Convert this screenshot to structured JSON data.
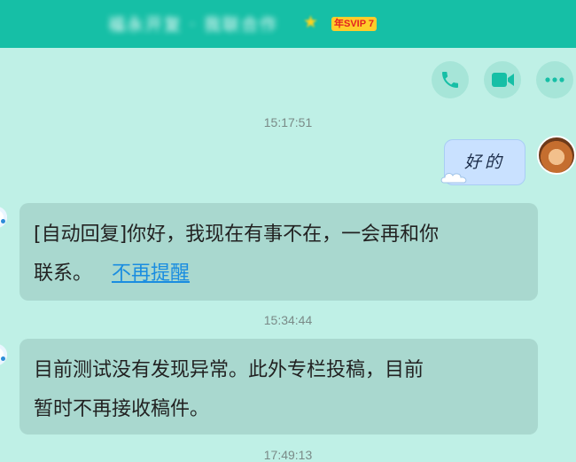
{
  "header": {
    "contact_name": "福永开复 · 我联合作",
    "vip_badge": "年SVIP 7",
    "star_icon": "star-icon"
  },
  "actions": {
    "call": "phone-icon",
    "video": "video-camera-icon",
    "more": "more-dots-icon"
  },
  "messages": [
    {
      "timestamp": "15:17:51",
      "side": "right",
      "text": "好的"
    },
    {
      "side": "left",
      "prefix": "[自动回复]",
      "text_line1": "你好，我现在有事不在，一会再和你",
      "text_line2": "联系。",
      "link": "不再提醒"
    },
    {
      "timestamp": "15:34:44",
      "side": "left",
      "text_line1": "目前测试没有发现异常。此外专栏投稿，目前",
      "text_line2": "暂时不再接收稿件。"
    },
    {
      "timestamp": "17:49:13"
    }
  ],
  "colors": {
    "header": "#16bfa6",
    "background": "#bff0e6",
    "bubble_left": "#a9d8cf",
    "bubble_right": "#c9e1ff",
    "link": "#1a8de0",
    "icon_accent": "#16bfa6"
  }
}
